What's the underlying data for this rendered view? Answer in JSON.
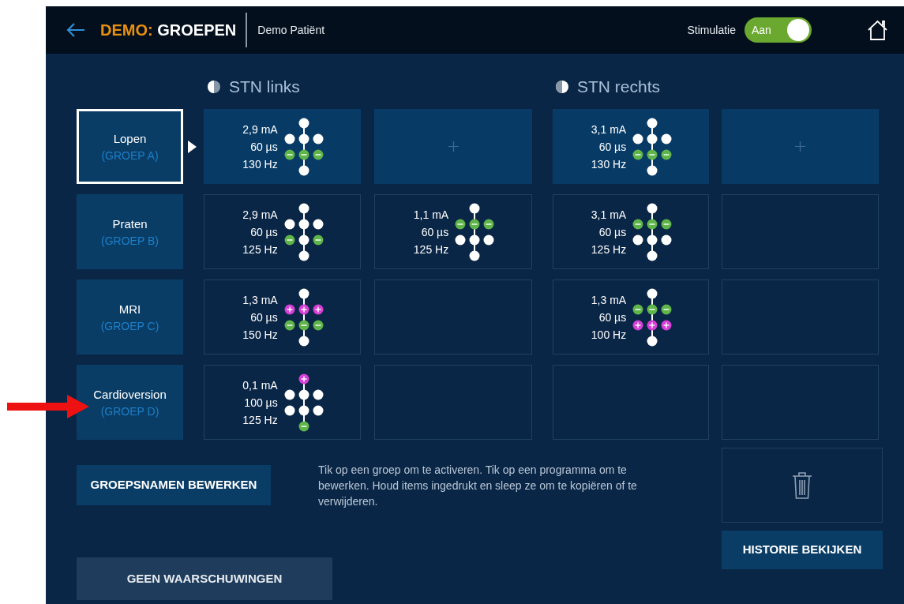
{
  "header": {
    "title_prefix": "DEMO:",
    "title": "GROEPEN",
    "patient": "Demo Patiënt",
    "stimulation": {
      "label": "Stimulatie",
      "state_label": "Aan",
      "on": true
    }
  },
  "hemispheres": [
    {
      "label": "STN links",
      "kind": "left"
    },
    {
      "label": "STN rechts",
      "kind": "right"
    }
  ],
  "groups": [
    {
      "name": "Lopen",
      "code": "(GROEP A)",
      "selected": true,
      "programs": [
        {
          "kind": "program",
          "amplitude": "2,9 mA",
          "pulse_width": "60 µs",
          "rate": "130 Hz",
          "contacts": [
            {
              "kind": "off"
            },
            {
              "kind": "off"
            },
            {
              "kind": "off"
            },
            {
              "kind": "off"
            },
            {
              "kind": "cathode"
            },
            {
              "kind": "cathode"
            },
            {
              "kind": "cathode"
            },
            {
              "kind": "off"
            }
          ]
        },
        {
          "kind": "add"
        },
        {
          "kind": "program",
          "amplitude": "3,1 mA",
          "pulse_width": "60 µs",
          "rate": "130 Hz",
          "contacts": [
            {
              "kind": "off"
            },
            {
              "kind": "off"
            },
            {
              "kind": "off"
            },
            {
              "kind": "off"
            },
            {
              "kind": "cathode"
            },
            {
              "kind": "cathode"
            },
            {
              "kind": "cathode"
            },
            {
              "kind": "off"
            }
          ]
        },
        {
          "kind": "add"
        }
      ]
    },
    {
      "name": "Praten",
      "code": "(GROEP B)",
      "selected": false,
      "programs": [
        {
          "kind": "program",
          "amplitude": "2,9 mA",
          "pulse_width": "60 µs",
          "rate": "125 Hz",
          "contacts": [
            {
              "kind": "off"
            },
            {
              "kind": "off"
            },
            {
              "kind": "off"
            },
            {
              "kind": "off"
            },
            {
              "kind": "cathode"
            },
            {
              "kind": "off"
            },
            {
              "kind": "cathode"
            },
            {
              "kind": "off"
            }
          ]
        },
        {
          "kind": "program",
          "amplitude": "1,1 mA",
          "pulse_width": "60 µs",
          "rate": "125 Hz",
          "contacts": [
            {
              "kind": "off"
            },
            {
              "kind": "cathode"
            },
            {
              "kind": "cathode"
            },
            {
              "kind": "cathode"
            },
            {
              "kind": "off"
            },
            {
              "kind": "off"
            },
            {
              "kind": "off"
            },
            {
              "kind": "off"
            }
          ]
        },
        {
          "kind": "program",
          "amplitude": "3,1 mA",
          "pulse_width": "60 µs",
          "rate": "125 Hz",
          "contacts": [
            {
              "kind": "off"
            },
            {
              "kind": "cathode"
            },
            {
              "kind": "cathode"
            },
            {
              "kind": "cathode"
            },
            {
              "kind": "off"
            },
            {
              "kind": "off"
            },
            {
              "kind": "off"
            },
            {
              "kind": "off"
            }
          ]
        },
        {
          "kind": "empty"
        }
      ]
    },
    {
      "name": "MRI",
      "code": "(GROEP C)",
      "selected": false,
      "programs": [
        {
          "kind": "program",
          "amplitude": "1,3 mA",
          "pulse_width": "60 µs",
          "rate": "150 Hz",
          "contacts": [
            {
              "kind": "off"
            },
            {
              "kind": "anode"
            },
            {
              "kind": "anode"
            },
            {
              "kind": "anode"
            },
            {
              "kind": "cathode"
            },
            {
              "kind": "cathode"
            },
            {
              "kind": "cathode"
            },
            {
              "kind": "off"
            }
          ]
        },
        {
          "kind": "empty"
        },
        {
          "kind": "program",
          "amplitude": "1,3 mA",
          "pulse_width": "60 µs",
          "rate": "100 Hz",
          "contacts": [
            {
              "kind": "off"
            },
            {
              "kind": "cathode"
            },
            {
              "kind": "cathode"
            },
            {
              "kind": "cathode"
            },
            {
              "kind": "anode"
            },
            {
              "kind": "anode"
            },
            {
              "kind": "anode"
            },
            {
              "kind": "off"
            }
          ]
        },
        {
          "kind": "empty"
        }
      ]
    },
    {
      "name": "Cardioversion",
      "code": "(GROEP D)",
      "selected": false,
      "programs": [
        {
          "kind": "program",
          "amplitude": "0,1 mA",
          "pulse_width": "100 µs",
          "rate": "125 Hz",
          "contacts": [
            {
              "kind": "anode"
            },
            {
              "kind": "off"
            },
            {
              "kind": "off"
            },
            {
              "kind": "off"
            },
            {
              "kind": "off"
            },
            {
              "kind": "off"
            },
            {
              "kind": "off"
            },
            {
              "kind": "cathode"
            }
          ]
        },
        {
          "kind": "empty"
        },
        {
          "kind": "empty"
        },
        {
          "kind": "empty"
        }
      ]
    }
  ],
  "edit_names_button": "GROEPSNAMEN BEWERKEN",
  "help_text": "Tik op een groep om te activeren. Tik op een programma om te bewerken. Houd items ingedrukt en sleep ze om te kopiëren of te verwijderen.",
  "history_button": "HISTORIE BEKIJKEN",
  "warnings_button": "GEEN WAARSCHUWINGEN"
}
